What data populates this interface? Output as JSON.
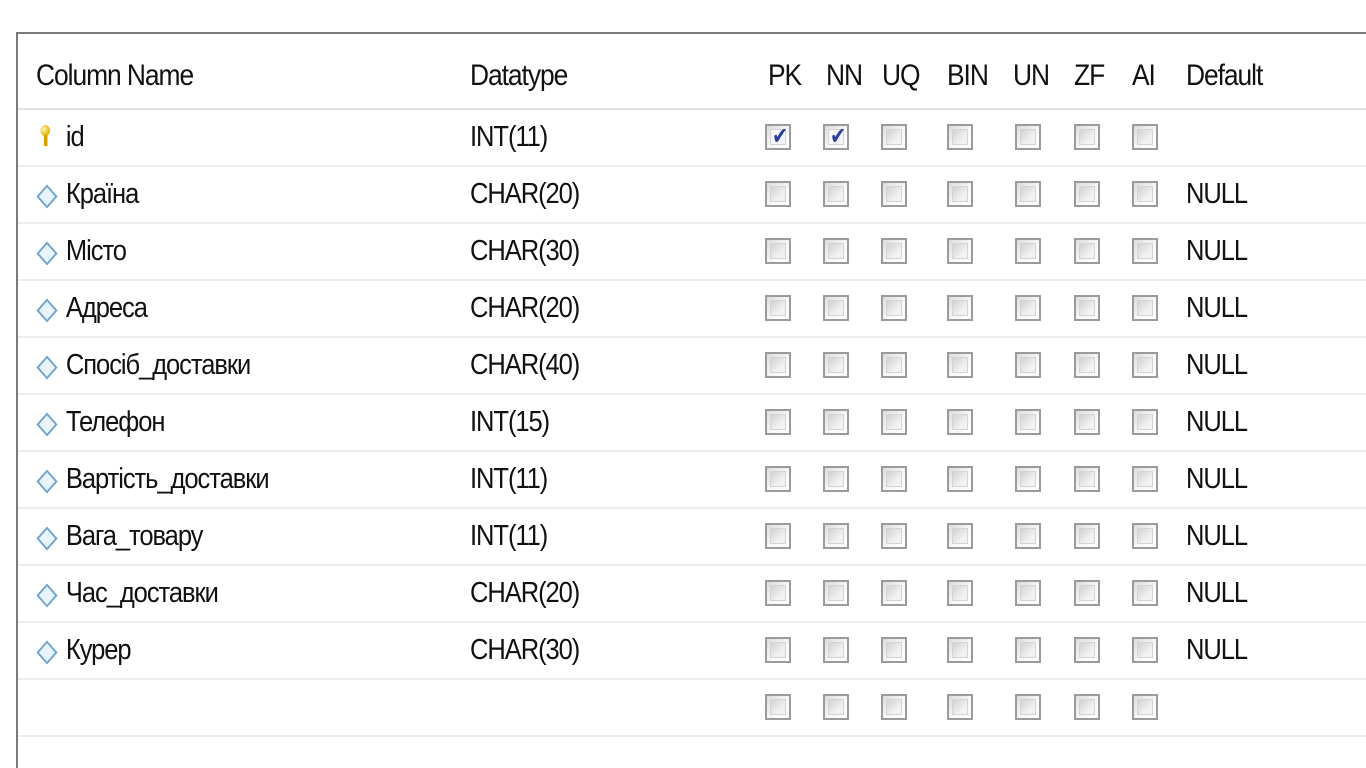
{
  "headers": {
    "column_name": "Column Name",
    "datatype": "Datatype",
    "flags": [
      "PK",
      "NN",
      "UQ",
      "BIN",
      "UN",
      "ZF",
      "AI"
    ],
    "default": "Default"
  },
  "rows": [
    {
      "icon": "primary-key-icon",
      "name": "id",
      "type": "INT(11)",
      "flags": [
        true,
        true,
        false,
        false,
        false,
        false,
        false
      ],
      "default": ""
    },
    {
      "icon": "column-diamond-icon",
      "name": "Країна",
      "type": "CHAR(20)",
      "flags": [
        false,
        false,
        false,
        false,
        false,
        false,
        false
      ],
      "default": "NULL"
    },
    {
      "icon": "column-diamond-icon",
      "name": "Місто",
      "type": "CHAR(30)",
      "flags": [
        false,
        false,
        false,
        false,
        false,
        false,
        false
      ],
      "default": "NULL"
    },
    {
      "icon": "column-diamond-icon",
      "name": "Адреса",
      "type": "CHAR(20)",
      "flags": [
        false,
        false,
        false,
        false,
        false,
        false,
        false
      ],
      "default": "NULL"
    },
    {
      "icon": "column-diamond-icon",
      "name": "Спосіб_доставки",
      "type": "CHAR(40)",
      "flags": [
        false,
        false,
        false,
        false,
        false,
        false,
        false
      ],
      "default": "NULL"
    },
    {
      "icon": "column-diamond-icon",
      "name": "Телефон",
      "type": "INT(15)",
      "flags": [
        false,
        false,
        false,
        false,
        false,
        false,
        false
      ],
      "default": "NULL"
    },
    {
      "icon": "column-diamond-icon",
      "name": "Вартість_доставки",
      "type": "INT(11)",
      "flags": [
        false,
        false,
        false,
        false,
        false,
        false,
        false
      ],
      "default": "NULL"
    },
    {
      "icon": "column-diamond-icon",
      "name": "Вага_товару",
      "type": "INT(11)",
      "flags": [
        false,
        false,
        false,
        false,
        false,
        false,
        false
      ],
      "default": "NULL"
    },
    {
      "icon": "column-diamond-icon",
      "name": "Час_доставки",
      "type": "CHAR(20)",
      "flags": [
        false,
        false,
        false,
        false,
        false,
        false,
        false
      ],
      "default": "NULL"
    },
    {
      "icon": "column-diamond-icon",
      "name": "Курер",
      "type": "CHAR(30)",
      "flags": [
        false,
        false,
        false,
        false,
        false,
        false,
        false
      ],
      "default": "NULL"
    },
    {
      "icon": "",
      "name": "",
      "type": "",
      "flags": [
        false,
        false,
        false,
        false,
        false,
        false,
        false
      ],
      "default": ""
    }
  ],
  "colors": {
    "check_mark": "#2a3f9a",
    "key": "#e5b400",
    "diamond": "#6fa3c9",
    "grid_line": "#ececec"
  }
}
